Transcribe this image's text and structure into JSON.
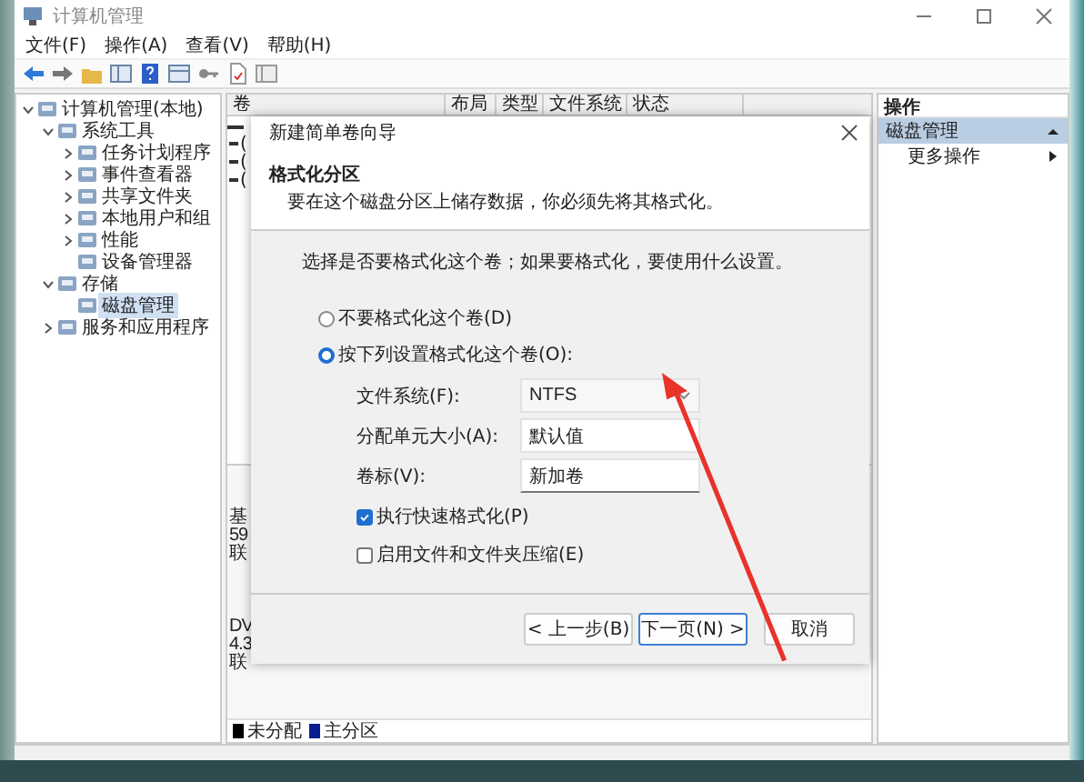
{
  "window": {
    "title": "计算机管理"
  },
  "menu": [
    "文件(F)",
    "操作(A)",
    "查看(V)",
    "帮助(H)"
  ],
  "tree": [
    {
      "label": "计算机管理(本地)",
      "expanded": true,
      "selected": false,
      "children": [
        {
          "label": "系统工具",
          "expanded": true,
          "selected": false,
          "children": [
            {
              "label": "任务计划程序",
              "expanded": false,
              "selected": false
            },
            {
              "label": "事件查看器",
              "expanded": false,
              "selected": false
            },
            {
              "label": "共享文件夹",
              "expanded": false,
              "selected": false
            },
            {
              "label": "本地用户和组",
              "expanded": false,
              "selected": false
            },
            {
              "label": "性能",
              "expanded": false,
              "selected": false
            },
            {
              "label": "设备管理器",
              "selected": false
            }
          ]
        },
        {
          "label": "存储",
          "expanded": true,
          "selected": false,
          "children": [
            {
              "label": "磁盘管理",
              "selected": true
            }
          ]
        },
        {
          "label": "服务和应用程序",
          "expanded": false,
          "selected": false
        }
      ]
    }
  ],
  "volume_table": {
    "columns": [
      "卷",
      "布局",
      "类型",
      "文件系统",
      "状态"
    ],
    "rows": [
      "(",
      "(",
      "("
    ]
  },
  "disks": [
    {
      "lines": [
        "基",
        "59",
        "联"
      ]
    },
    {
      "lines": [
        "DV",
        "4.3",
        "联"
      ]
    }
  ],
  "legend": [
    {
      "label": "未分配",
      "color": "#000000"
    },
    {
      "label": "主分区",
      "color": "#0a1f8f"
    }
  ],
  "actions": {
    "header": "操作",
    "section": {
      "label": "磁盘管理",
      "expanded": true
    },
    "items": [
      {
        "label": "更多操作"
      }
    ]
  },
  "dialog": {
    "title": "新建简单卷向导",
    "heading": "格式化分区",
    "subtitle": "要在这个磁盘分区上储存数据，你必须先将其格式化。",
    "intro": "选择是否要格式化这个卷；如果要格式化，要使用什么设置。",
    "radios": [
      {
        "label": "不要格式化这个卷(D)",
        "selected": false
      },
      {
        "label": "按下列设置格式化这个卷(O):",
        "selected": true
      }
    ],
    "fields": [
      {
        "label": "文件系统(F):",
        "kind": "combo",
        "value": "NTFS"
      },
      {
        "label": "分配单元大小(A):",
        "kind": "text",
        "value": "默认值"
      },
      {
        "label": "卷标(V):",
        "kind": "input",
        "value": "新加卷"
      }
    ],
    "checkboxes": [
      {
        "label": "执行快速格式化(P)",
        "checked": true
      },
      {
        "label": "启用文件和文件夹压缩(E)",
        "checked": false
      }
    ],
    "buttons": [
      {
        "label": "< 上一步(B)",
        "kind": "normal"
      },
      {
        "label": "下一页(N) >",
        "kind": "default"
      },
      {
        "label": "取消",
        "kind": "cancel"
      }
    ]
  }
}
